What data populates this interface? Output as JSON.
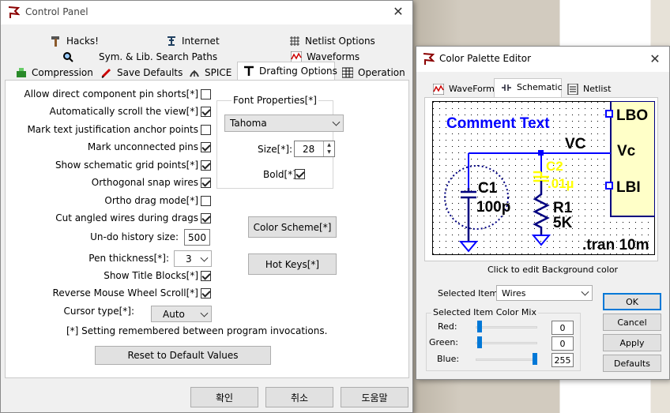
{
  "control_panel": {
    "title": "Control Panel",
    "tabs_row1": [
      "Hacks!",
      "Internet",
      "Netlist Options"
    ],
    "tabs_row2": [
      "Sym. & Lib. Search Paths",
      "Waveforms"
    ],
    "tabs_row3": [
      "Compression",
      "Save Defaults",
      "SPICE",
      "Drafting Options",
      "Operation"
    ],
    "checkbox_options": [
      {
        "label": "Allow direct component pin shorts[*]",
        "checked": false
      },
      {
        "label": "Automatically scroll the view[*]",
        "checked": true
      },
      {
        "label": "Mark text justification anchor points",
        "checked": false
      },
      {
        "label": "Mark unconnected pins",
        "checked": true
      },
      {
        "label": "Show schematic grid points[*]",
        "checked": true
      },
      {
        "label": "Orthogonal snap wires",
        "checked": true
      },
      {
        "label": "Ortho drag mode[*]",
        "checked": false
      },
      {
        "label": "Cut angled wires during drags",
        "checked": true
      }
    ],
    "undo_label": "Un-do history size:",
    "undo_value": "500",
    "pen_label": "Pen thickness[*]:",
    "pen_value": "3",
    "show_title_blocks_label": "Show Title Blocks[*]",
    "show_title_blocks_checked": true,
    "reverse_wheel_label": "Reverse Mouse Wheel Scroll[*]",
    "reverse_wheel_checked": true,
    "cursor_label": "Cursor type[*]:",
    "cursor_value": "Auto",
    "footnote": "[*] Setting remembered between program invocations.",
    "reset_button": "Reset to Default Values",
    "font_group_title": "Font Properties[*]",
    "font_value": "Tahoma",
    "size_label": "Size[*]:",
    "size_value": "28",
    "bold_label": "Bold[*]",
    "bold_checked": true,
    "color_scheme_button": "Color Scheme[*]",
    "hot_keys_button": "Hot Keys[*]",
    "ok_button": "확인",
    "cancel_button": "취소",
    "help_button": "도움말"
  },
  "palette_editor": {
    "title": "Color Palette Editor",
    "tabs": [
      "WaveForm",
      "Schematic",
      "Netlist"
    ],
    "preview": {
      "comment": "Comment Text",
      "vc_net": "VC",
      "pin_lbo": "LBO",
      "pin_vc": "Vc",
      "pin_lbi": "LBI",
      "cap_c1": "C1",
      "cap_c1_val": "100p",
      "cap_c2": "C2",
      "cap_c2_val": ".01µ",
      "res_r1": "R1",
      "res_r1_val": "5K",
      "directive": ".tran 10m"
    },
    "hint": "Click to edit Background color",
    "selected_item_label": "Selected Item:",
    "selected_item_value": "Wires",
    "mix_group_title": "Selected Item Color Mix",
    "red_label": "Red:",
    "red_value": "0",
    "green_label": "Green:",
    "green_value": "0",
    "blue_label": "Blue:",
    "blue_value": "255",
    "ok_button": "OK",
    "cancel_button": "Cancel",
    "apply_button": "Apply",
    "defaults_button": "Defaults"
  },
  "colors": {
    "wire": "#0000ff",
    "selected": "#ffff00",
    "component": "#000080",
    "comment": "#0000ff",
    "block_fill": "#ffffc8",
    "accent": "#0078d7"
  }
}
